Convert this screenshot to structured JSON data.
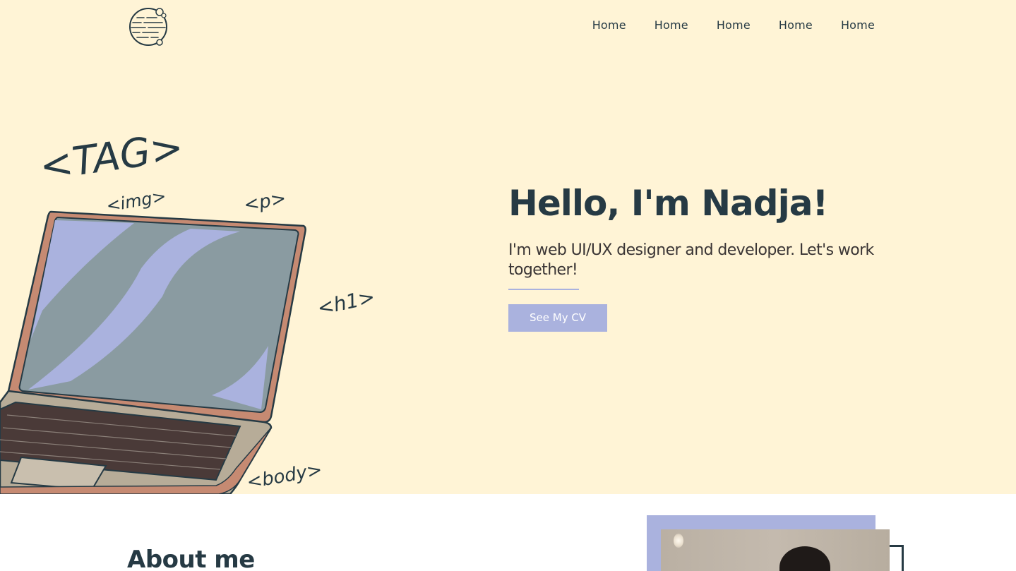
{
  "nav": {
    "items": [
      {
        "label": "Home"
      },
      {
        "label": "Home"
      },
      {
        "label": "Home"
      },
      {
        "label": "Home"
      },
      {
        "label": "Home"
      }
    ]
  },
  "hero": {
    "title": "Hello, I'm Nadja!",
    "subtitle": "I'm web UI/UX designer and developer. Let's work together!",
    "cv_button": "See My CV",
    "illustration_tags": {
      "tag": "<TAG>",
      "img": "<img>",
      "p": "<p>",
      "h1": "<h1>",
      "body": "<body>"
    }
  },
  "about": {
    "title": "About me"
  },
  "colors": {
    "hero_bg": "#fff4d6",
    "accent": "#aab2de",
    "text_dark": "#263a44"
  },
  "icons": {
    "logo": "planet-logo-icon"
  }
}
